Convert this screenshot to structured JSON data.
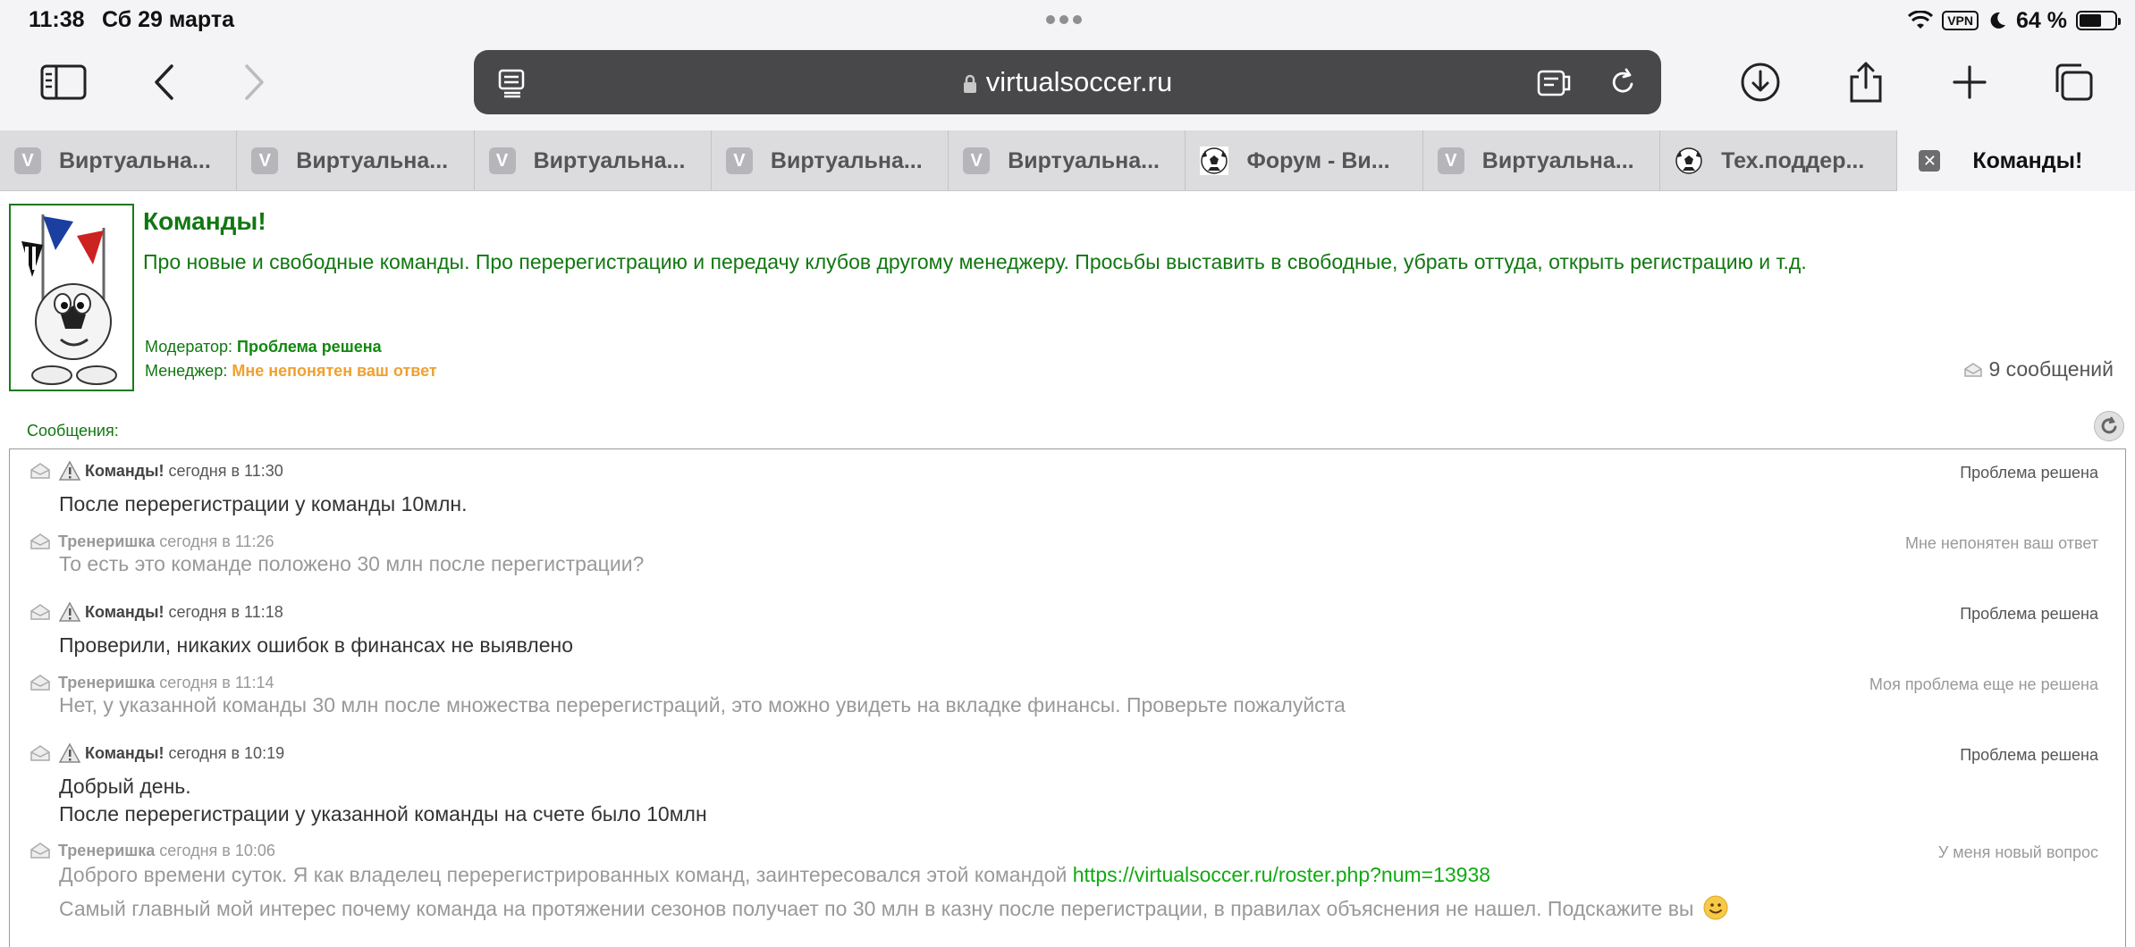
{
  "status_bar": {
    "time": "11:38",
    "date": "Сб 29 марта",
    "vpn": "VPN",
    "battery": "64 %",
    "battery_level": 0.64
  },
  "browser": {
    "address": "virtualsoccer.ru",
    "tabs": [
      {
        "label": "Виртуальна...",
        "icon": "v-favicon"
      },
      {
        "label": "Виртуальна...",
        "icon": "v-favicon"
      },
      {
        "label": "Виртуальна...",
        "icon": "v-favicon"
      },
      {
        "label": "Виртуальна...",
        "icon": "v-favicon"
      },
      {
        "label": "Виртуальна...",
        "icon": "v-favicon"
      },
      {
        "label": "Форум - Ви...",
        "icon": "soccer-ball-favicon"
      },
      {
        "label": "Виртуальна...",
        "icon": "v-favicon"
      },
      {
        "label": "Тех.поддер...",
        "icon": "soccer-ball-favicon"
      },
      {
        "label": "Команды!",
        "icon": "close-icon",
        "active": true
      }
    ],
    "favicon_letter": "V"
  },
  "forum": {
    "title": "Команды!",
    "description": "Про новые и свободные команды. Про перерегистрацию и передачу клубов другому менеджеру. Просьбы выставить в свободные, убрать оттуда, открыть регистрацию и т.д.",
    "moderator_label": "Модератор:",
    "moderator_value": "Проблема решена",
    "manager_label": "Менеджер:",
    "manager_value": "Мне непонятен ваш ответ",
    "message_count": "9 сообщений",
    "messages_label": "Сообщения:",
    "accent_color": "#117711"
  },
  "messages": [
    {
      "author": "Команды!",
      "time": "сегодня в 11:30",
      "status": "Проблема решена",
      "lines": [
        "После перерегистрации у команды 10млн."
      ]
    },
    {
      "author": "Тренеришка",
      "time": "сегодня в 11:26",
      "status": "Мне непонятен ваш ответ",
      "lines": [
        "То есть это команде положено 30 млн после перегистрации?"
      ]
    },
    {
      "author": "Команды!",
      "time": "сегодня в 11:18",
      "status": "Проблема решена",
      "lines": [
        "Проверили, никаких ошибок в финансах не выявлено"
      ]
    },
    {
      "author": "Тренеришка",
      "time": "сегодня в 11:14",
      "status": "Моя проблема еще не решена",
      "lines": [
        "Нет, у указанной команды 30 млн после множества перерегистраций, это можно увидеть на вкладке финансы. Проверьте пожалуйста"
      ]
    },
    {
      "author": "Команды!",
      "time": "сегодня в 10:19",
      "status": "Проблема решена",
      "lines": [
        "Добрый день.",
        "После перерегистрации у указанной команды на счете было 10млн"
      ]
    },
    {
      "author": "Тренеришка",
      "time": "сегодня в 10:06",
      "status": "У меня новый вопрос",
      "line1_text": "Доброго времени суток. Я как владелец перерегистрированных команд, заинтересовался этой командой",
      "line1_link": "https://virtualsoccer.ru/roster.php?num=13938",
      "line2_text": "Самый главный мой интерес почему команда на протяжении сезонов получает по 30 млн в казну после перегистрации, в правилах объяснения не нашел. Подскажите вы"
    }
  ]
}
